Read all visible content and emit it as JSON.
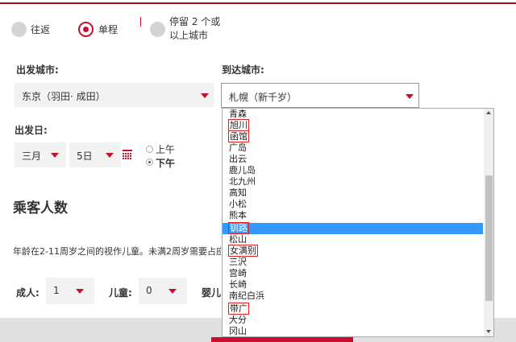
{
  "trip": {
    "options": [
      {
        "label": "往返",
        "selected": false
      },
      {
        "label": "单程",
        "selected": true
      },
      {
        "label_line1": "停留 2 个或",
        "label_line2": "以上城市",
        "selected": false
      }
    ]
  },
  "departure": {
    "label": "出发城市:",
    "value": "东京（羽田· 成田）"
  },
  "arrival": {
    "label": "到达城市:",
    "value": "札幌（新千岁）",
    "options": [
      {
        "text": "青森",
        "boxed": false,
        "highlighted": false
      },
      {
        "text": "旭川",
        "boxed": true,
        "highlighted": false
      },
      {
        "text": "函馆",
        "boxed": true,
        "highlighted": false
      },
      {
        "text": "广岛",
        "boxed": false,
        "highlighted": false
      },
      {
        "text": "出云",
        "boxed": false,
        "highlighted": false
      },
      {
        "text": "鹿儿岛",
        "boxed": false,
        "highlighted": false
      },
      {
        "text": "北九州",
        "boxed": false,
        "highlighted": false
      },
      {
        "text": "高知",
        "boxed": false,
        "highlighted": false
      },
      {
        "text": "小松",
        "boxed": false,
        "highlighted": false
      },
      {
        "text": "熊本",
        "boxed": false,
        "highlighted": false
      },
      {
        "text": "钏路",
        "boxed": true,
        "highlighted": true
      },
      {
        "text": "松山",
        "boxed": false,
        "highlighted": false
      },
      {
        "text": "女满别",
        "boxed": true,
        "highlighted": false
      },
      {
        "text": "三沢",
        "boxed": false,
        "highlighted": false
      },
      {
        "text": "宫崎",
        "boxed": false,
        "highlighted": false
      },
      {
        "text": "长崎",
        "boxed": false,
        "highlighted": false
      },
      {
        "text": "南纪白浜",
        "boxed": false,
        "highlighted": false
      },
      {
        "text": "带广",
        "boxed": true,
        "highlighted": false
      },
      {
        "text": "大分",
        "boxed": false,
        "highlighted": false
      },
      {
        "text": "冈山",
        "boxed": false,
        "highlighted": false
      }
    ]
  },
  "date": {
    "label": "出发日:",
    "month": "三月",
    "day": "5日",
    "calendar_icon": "calendar-icon",
    "am_label": "上午",
    "pm_label": "下午",
    "pm_selected": true
  },
  "passengers": {
    "heading": "乘客人数",
    "note": "年龄在2-11周岁之间的视作儿童。未满2周岁需要占座",
    "adult_label": "成人:",
    "adult_value": "1",
    "child_label": "儿童:",
    "child_value": "0",
    "infant_label": "婴儿"
  },
  "colors": {
    "accent": "#c8102e",
    "highlight": "#3399ff"
  }
}
